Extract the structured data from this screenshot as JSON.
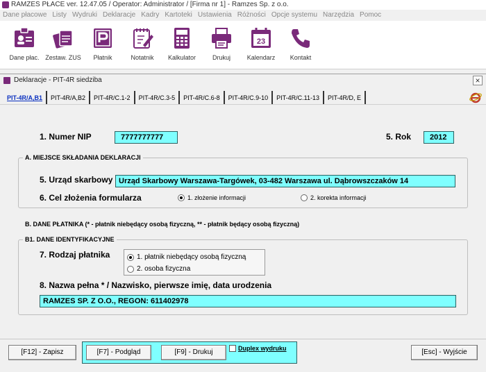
{
  "window": {
    "title": "RAMZES PŁACE ver. 12.47.05 /   Operator: Administrator /   [Firma nr 1] - Ramzes Sp. z o.o."
  },
  "menu": [
    "Dane płacowe",
    "Listy",
    "Wydruki",
    "Deklaracje",
    "Kadry",
    "Kartoteki",
    "Ustawienia",
    "Różności",
    "Opcje systemu",
    "Narzędzia",
    "Pomoc"
  ],
  "toolbar": [
    {
      "label": "Dane płac.",
      "icon": "employee-card-icon"
    },
    {
      "label": "Zestaw. ZUS",
      "icon": "zus-stack-icon"
    },
    {
      "label": "Płatnik",
      "icon": "platnik-icon"
    },
    {
      "label": "Notatnik",
      "icon": "notepad-icon"
    },
    {
      "label": "Kalkulator",
      "icon": "calculator-icon"
    },
    {
      "label": "Drukuj",
      "icon": "printer-icon"
    },
    {
      "label": "Kalendarz",
      "icon": "calendar-icon"
    },
    {
      "label": "Kontakt",
      "icon": "phone-icon"
    }
  ],
  "calendar_day": "23",
  "inner_window": {
    "title": "Deklaracje - PIT-4R siedziba",
    "close": "×"
  },
  "tabs": [
    "PIT-4R/A,B1",
    "PIT-4R/A,B2",
    "PIT-4R/C.1-2",
    "PIT-4R/C.3-5",
    "PIT-4R/C.6-8",
    "PIT-4R/C.9-10",
    "PIT-4R/C.11-13",
    "PIT-4R/D, E"
  ],
  "active_tab": 0,
  "form": {
    "nip_label": "1. Numer NIP",
    "nip_value": "7777777777",
    "rok_label": "5. Rok",
    "rok_value": "2012",
    "section_a": "A. MIEJSCE SKŁADANIA DEKLARACJI",
    "urzad_label": "5. Urząd skarbowy",
    "urzad_value": "Urząd Skarbowy Warszawa-Targówek, 03-482 Warszawa ul. Dąbrowszczaków 14",
    "cel_label": "6. Cel złożenia formularza",
    "cel_option1": "1. złożenie informacji",
    "cel_option2": "2. korekta informacji",
    "section_b": "B. DANE PŁATNIKA (* - płatnik niebędący osobą fizyczną, ** - płatnik będący osobą fizyczną)",
    "section_b1": "B1. DANE IDENTYFIKACYJNE",
    "rodzaj_label": "7. Rodzaj płatnika",
    "rodzaj_option1": "1. płatnik niebędący osobą fizyczną",
    "rodzaj_option2": "2. osoba fizyczna",
    "nazwa_label": "8. Nazwa pełna * / Nazwisko, pierwsze imię, data urodzenia",
    "nazwa_value": "RAMZES SP. Z O.O., REGON: 611402978"
  },
  "buttons": {
    "save": "[F12] - Zapisz",
    "preview": "[F7] - Podgląd",
    "print": "[F9] - Drukuj",
    "duplex": "Duplex wydruku",
    "exit": "[Esc] - Wyjście"
  }
}
